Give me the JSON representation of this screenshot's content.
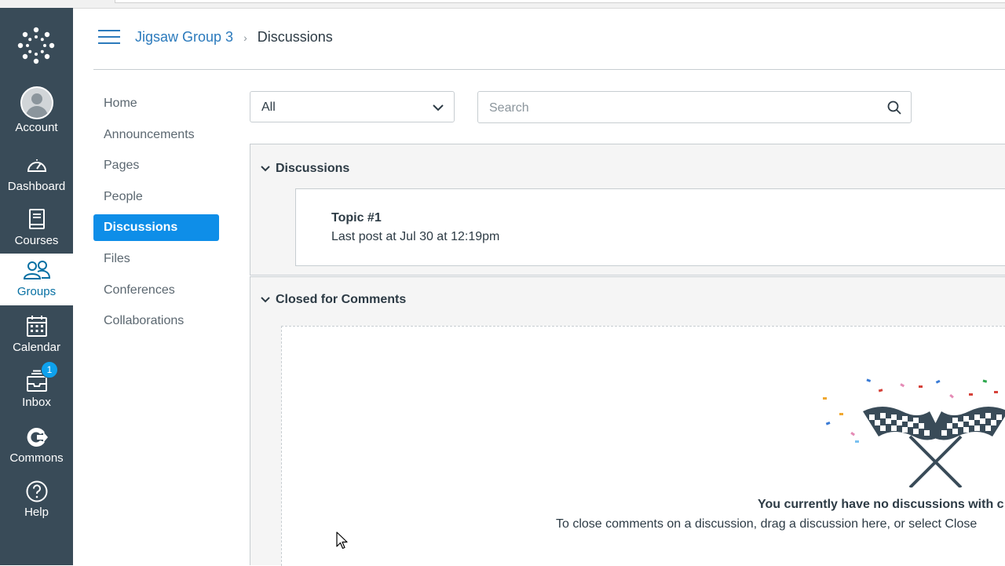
{
  "global_nav": {
    "account": "Account",
    "dashboard": "Dashboard",
    "courses": "Courses",
    "groups": "Groups",
    "calendar": "Calendar",
    "inbox": "Inbox",
    "inbox_badge": "1",
    "commons": "Commons",
    "help": "Help"
  },
  "breadcrumb": {
    "group": "Jigsaw Group 3",
    "current": "Discussions"
  },
  "course_nav": [
    "Home",
    "Announcements",
    "Pages",
    "People",
    "Discussions",
    "Files",
    "Conferences",
    "Collaborations"
  ],
  "filters": {
    "select_value": "All",
    "search_placeholder": "Search"
  },
  "sections": {
    "discussions": {
      "heading": "Discussions",
      "topic_title": "Topic #1",
      "topic_meta": "Last post at Jul 30 at 12:19pm"
    },
    "closed": {
      "heading": "Closed for Comments",
      "empty_title": "You currently have no discussions with c",
      "empty_desc": "To close comments on a discussion, drag a discussion here, or select Close"
    }
  },
  "colors": {
    "nav_bg": "#394b58",
    "link": "#2b7abc",
    "active_item": "#0e8ee8",
    "badge": "#0ea1ed"
  }
}
